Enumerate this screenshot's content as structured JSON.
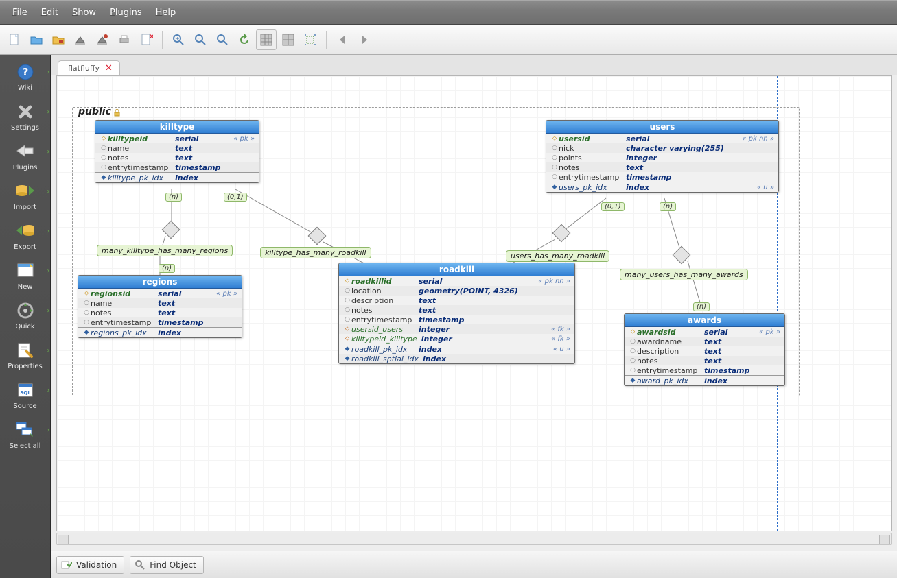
{
  "menu": {
    "file": "File",
    "edit": "Edit",
    "show": "Show",
    "plugins": "Plugins",
    "help": "Help"
  },
  "sidebar": {
    "wiki": "Wiki",
    "settings": "Settings",
    "plugins": "Plugins",
    "import": "Import",
    "export": "Export",
    "new": "New",
    "quick": "Quick",
    "properties": "Properties",
    "source": "Source",
    "select_all": "Select all"
  },
  "tab": {
    "name": "flatfluffy"
  },
  "schema": {
    "name": "public"
  },
  "statusbar": {
    "validation": "Validation",
    "find": "Find Object"
  },
  "cardinality": {
    "n": "(n)",
    "zero_one": "(0,1)"
  },
  "relations": {
    "killtype_regions": "many_killtype_has_many_regions",
    "killtype_roadkill": "killtype_has_many_roadkill",
    "users_roadkill": "users_has_many_roadkill",
    "users_awards": "many_users_has_many_awards"
  },
  "tables": {
    "killtype": {
      "title": "killtype",
      "cols": [
        {
          "name": "killtypeid",
          "type": "serial",
          "flag": "« pk »",
          "kind": "pk"
        },
        {
          "name": "name",
          "type": "text",
          "flag": "",
          "kind": "col"
        },
        {
          "name": "notes",
          "type": "text",
          "flag": "",
          "kind": "col"
        },
        {
          "name": "entrytimestamp",
          "type": "timestamp",
          "flag": "",
          "kind": "col"
        }
      ],
      "idx": [
        {
          "name": "killtype_pk_idx",
          "type": "index",
          "flag": ""
        }
      ]
    },
    "regions": {
      "title": "regions",
      "cols": [
        {
          "name": "regionsid",
          "type": "serial",
          "flag": "« pk »",
          "kind": "pk"
        },
        {
          "name": "name",
          "type": "text",
          "flag": "",
          "kind": "col"
        },
        {
          "name": "notes",
          "type": "text",
          "flag": "",
          "kind": "col"
        },
        {
          "name": "entrytimestamp",
          "type": "timestamp",
          "flag": "",
          "kind": "col"
        }
      ],
      "idx": [
        {
          "name": "regions_pk_idx",
          "type": "index",
          "flag": ""
        }
      ]
    },
    "users": {
      "title": "users",
      "cols": [
        {
          "name": "usersid",
          "type": "serial",
          "flag": "« pk nn »",
          "kind": "pk"
        },
        {
          "name": "nick",
          "type": "character varying(255)",
          "flag": "",
          "kind": "col"
        },
        {
          "name": "points",
          "type": "integer",
          "flag": "",
          "kind": "col"
        },
        {
          "name": "notes",
          "type": "text",
          "flag": "",
          "kind": "col"
        },
        {
          "name": "entrytimestamp",
          "type": "timestamp",
          "flag": "",
          "kind": "col"
        }
      ],
      "idx": [
        {
          "name": "users_pk_idx",
          "type": "index",
          "flag": "« u »"
        }
      ]
    },
    "roadkill": {
      "title": "roadkill",
      "cols": [
        {
          "name": "roadkillid",
          "type": "serial",
          "flag": "« pk nn »",
          "kind": "pk"
        },
        {
          "name": "location",
          "type": "geometry(POINT, 4326)",
          "flag": "",
          "kind": "col"
        },
        {
          "name": "description",
          "type": "text",
          "flag": "",
          "kind": "col"
        },
        {
          "name": "notes",
          "type": "text",
          "flag": "",
          "kind": "col"
        },
        {
          "name": "entrytimestamp",
          "type": "timestamp",
          "flag": "",
          "kind": "col"
        },
        {
          "name": "usersid_users",
          "type": "integer",
          "flag": "« fk »",
          "kind": "fk"
        },
        {
          "name": "killtypeid_killtype",
          "type": "integer",
          "flag": "« fk »",
          "kind": "fk"
        }
      ],
      "idx": [
        {
          "name": "roadkill_pk_idx",
          "type": "index",
          "flag": "« u »"
        },
        {
          "name": "roadkill_sptial_idx",
          "type": "index",
          "flag": ""
        }
      ]
    },
    "awards": {
      "title": "awards",
      "cols": [
        {
          "name": "awardsid",
          "type": "serial",
          "flag": "« pk »",
          "kind": "pk"
        },
        {
          "name": "awardname",
          "type": "text",
          "flag": "",
          "kind": "col"
        },
        {
          "name": "description",
          "type": "text",
          "flag": "",
          "kind": "col"
        },
        {
          "name": "notes",
          "type": "text",
          "flag": "",
          "kind": "col"
        },
        {
          "name": "entrytimestamp",
          "type": "timestamp",
          "flag": "",
          "kind": "col"
        }
      ],
      "idx": [
        {
          "name": "award_pk_idx",
          "type": "index",
          "flag": ""
        }
      ]
    }
  }
}
